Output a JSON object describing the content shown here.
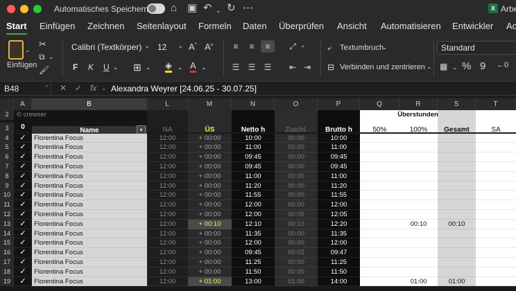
{
  "titlebar": {
    "autosave_label": "Automatisches Speichern",
    "doc_title": "Arbei",
    "app_badge": "X"
  },
  "tabs": [
    "Start",
    "Einfügen",
    "Zeichnen",
    "Seitenlayout",
    "Formeln",
    "Daten",
    "Überprüfen",
    "Ansicht",
    "Automatisieren",
    "Entwickler",
    "Ac"
  ],
  "ribbon": {
    "paste_label": "Einfügen",
    "font_name": "Calibri (Textkörper)",
    "font_size": "12",
    "bold": "F",
    "italic": "K",
    "underline": "U",
    "wrap_text": "Textumbruch",
    "merge_center": "Verbinden und zentrieren",
    "number_format": "Standard"
  },
  "formula_bar": {
    "name_box": "B48",
    "fx": "fx",
    "formula": "Alexandra Weyrer [24.06.25 - 30.07.25]"
  },
  "columns": [
    "A",
    "B",
    "L",
    "M",
    "N",
    "O",
    "P",
    "Q",
    "R",
    "S",
    "T"
  ],
  "header_rows": {
    "row2": {
      "num": "2",
      "a_b": "© crewser",
      "overtime_group": "Überstunden"
    },
    "row3": {
      "num": "3",
      "a": "0",
      "b": "Name",
      "l": "NA",
      "m": "ÜS",
      "n": "Netto h",
      "o": "Zuschl.",
      "p": "Brutto h",
      "q": "50%",
      "r": "100%",
      "s": "Gesamt",
      "t": "SA"
    }
  },
  "rows": [
    {
      "num": "4",
      "check": "✓",
      "name": "Florentina Focus",
      "l": "12:00",
      "m": "+ 00:00",
      "n": "10:00",
      "o": "00:00",
      "p": "10:00",
      "r": "",
      "s": ""
    },
    {
      "num": "5",
      "check": "✓",
      "name": "Florentina Focus",
      "l": "12:00",
      "m": "+ 00:00",
      "n": "11:00",
      "o": "00:00",
      "p": "11:00",
      "r": "",
      "s": ""
    },
    {
      "num": "6",
      "check": "✓",
      "name": "Florentina Focus",
      "l": "12:00",
      "m": "+ 00:00",
      "n": "09:45",
      "o": "00:00",
      "p": "09:45",
      "r": "",
      "s": ""
    },
    {
      "num": "7",
      "check": "✓",
      "name": "Florentina Focus",
      "l": "12:00",
      "m": "+ 00:00",
      "n": "09:45",
      "o": "00:00",
      "p": "09:45",
      "r": "",
      "s": ""
    },
    {
      "num": "8",
      "check": "✓",
      "name": "Florentina Focus",
      "l": "12:00",
      "m": "+ 00:00",
      "n": "11:00",
      "o": "00:00",
      "p": "11:00",
      "r": "",
      "s": ""
    },
    {
      "num": "9",
      "check": "✓",
      "name": "Florentina Focus",
      "l": "12:00",
      "m": "+ 00:00",
      "n": "11:20",
      "o": "00:00",
      "p": "11:20",
      "r": "",
      "s": ""
    },
    {
      "num": "10",
      "check": "✓",
      "name": "Florentina Focus",
      "l": "12:00",
      "m": "+ 00:00",
      "n": "11:55",
      "o": "00:00",
      "p": "11:55",
      "r": "",
      "s": ""
    },
    {
      "num": "11",
      "check": "✓",
      "name": "Florentina Focus",
      "l": "12:00",
      "m": "+ 00:00",
      "n": "12:00",
      "o": "00:00",
      "p": "12:00",
      "r": "",
      "s": ""
    },
    {
      "num": "12",
      "check": "✓",
      "name": "Florentina Focus",
      "l": "12:00",
      "m": "+ 00:00",
      "n": "12:00",
      "o": "00:05",
      "p": "12:05",
      "r": "",
      "s": ""
    },
    {
      "num": "13",
      "check": "✓",
      "name": "Florentina Focus",
      "l": "12:00",
      "m": "+ 00:10",
      "n": "12:10",
      "o": "00:10",
      "p": "12:20",
      "r": "00:10",
      "s": "00:10",
      "hl": true
    },
    {
      "num": "14",
      "check": "✓",
      "name": "Florentina Focus",
      "l": "12:00",
      "m": "+ 00:00",
      "n": "11:35",
      "o": "00:00",
      "p": "11:35",
      "r": "",
      "s": ""
    },
    {
      "num": "15",
      "check": "✓",
      "name": "Florentina Focus",
      "l": "12:00",
      "m": "+ 00:00",
      "n": "12:00",
      "o": "00:00",
      "p": "12:00",
      "r": "",
      "s": ""
    },
    {
      "num": "16",
      "check": "✓",
      "name": "Florentina Focus",
      "l": "12:00",
      "m": "+ 00:00",
      "n": "09:45",
      "o": "00:02",
      "p": "09:47",
      "r": "",
      "s": ""
    },
    {
      "num": "17",
      "check": "✓",
      "name": "Florentina Focus",
      "l": "12:00",
      "m": "+ 00:00",
      "n": "11:25",
      "o": "00:00",
      "p": "11:25",
      "r": "",
      "s": ""
    },
    {
      "num": "18",
      "check": "✓",
      "name": "Florentina Focus",
      "l": "12:00",
      "m": "+ 00:00",
      "n": "11:50",
      "o": "00:00",
      "p": "11:50",
      "r": "",
      "s": ""
    },
    {
      "num": "19",
      "check": "✓",
      "name": "Florentina Focus",
      "l": "12:00",
      "m": "+ 01:00",
      "n": "13:00",
      "o": "01:00",
      "p": "14:00",
      "r": "01:00",
      "s": "01:00",
      "hl": true
    }
  ],
  "colors": {
    "accent_green": "#4ea04e",
    "highlight_yellow": "#f2f25a",
    "dark_column": "#0e0e0e",
    "grey_column": "#d6d6d6"
  }
}
